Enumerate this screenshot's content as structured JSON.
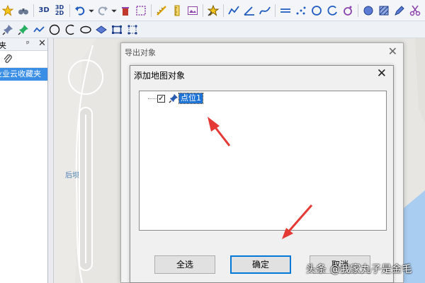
{
  "toolbar": {
    "btn_3d": "3D",
    "btn_3d2d_top": "3D",
    "btn_3d2d_bottom": "2D"
  },
  "left_panel": {
    "title": "夹",
    "pin": "ᵖ",
    "close": "✕",
    "item": "业业云收藏夹"
  },
  "map": {
    "label": "后坝"
  },
  "outer_dialog": {
    "title": "导出对象",
    "close": "✕"
  },
  "inner_dialog": {
    "title": "添加地图对象",
    "close": "✕",
    "tree": {
      "checked": "✓",
      "label": "点位1"
    },
    "buttons": {
      "select_all": "全选",
      "ok": "确定",
      "cancel": "取消"
    }
  },
  "watermark": "头条 @我家丸子是金毛"
}
